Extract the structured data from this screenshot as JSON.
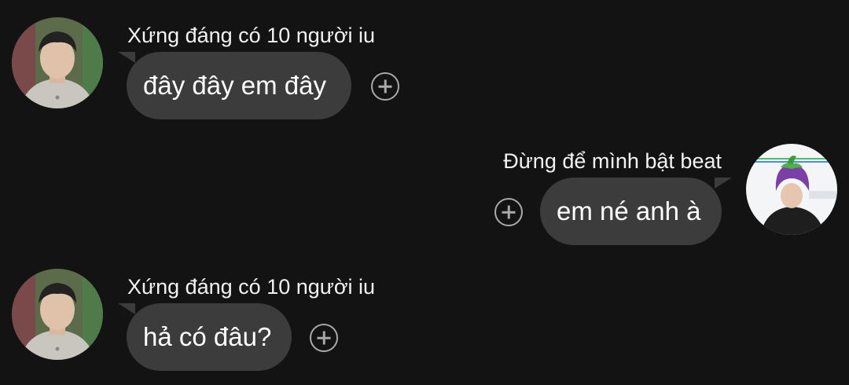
{
  "messages": [
    {
      "sender": "Xứng đáng có 10 người iu",
      "text": "đây đây em đây",
      "avatar_icon": "boy-portrait-avatar",
      "react_icon": "add-reaction-icon"
    },
    {
      "sender": "Đừng để mình bật beat",
      "text": "em né anh à",
      "avatar_icon": "eggplant-hat-avatar",
      "react_icon": "add-reaction-icon"
    },
    {
      "sender": "Xứng đáng có 10 người iu",
      "text": "hả có đâu?",
      "avatar_icon": "boy-portrait-avatar",
      "react_icon": "add-reaction-icon"
    }
  ],
  "colors": {
    "background": "#131313",
    "bubble": "#3c3c3c",
    "text": "#ffffff",
    "icon": "#a9a9a9"
  }
}
